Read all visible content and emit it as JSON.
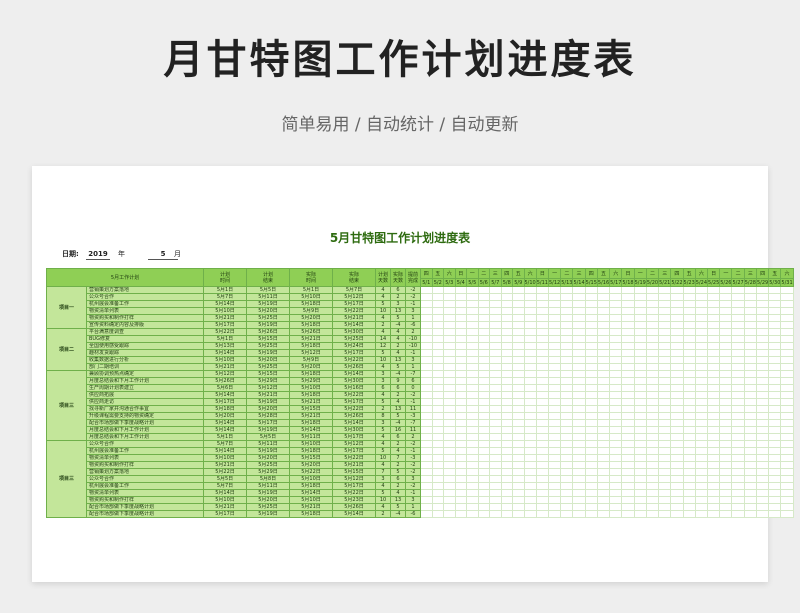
{
  "page": {
    "title": "月甘特图工作计划进度表",
    "subtitle": "简单易用 / 自动统计 / 自动更新"
  },
  "sheet": {
    "title": "5月甘特图工作计划进度表",
    "date_label": "日期:",
    "year": "2019",
    "year_unit": "年",
    "month": "5",
    "month_unit": "月"
  },
  "table": {
    "headers": {
      "plan": "5月工作计划",
      "plan_start": "计划\n时间",
      "plan_end": "计划\n结束",
      "actual_start": "实际\n时间",
      "actual_end": "实际\n结束",
      "plan_days": "计划\n天数",
      "actual_days": "实际\n天数",
      "early_finish": "提前\n完成"
    },
    "weekdays": [
      "四",
      "五",
      "六",
      "日",
      "一",
      "二",
      "三",
      "四",
      "五",
      "六",
      "日",
      "一",
      "二",
      "三",
      "四",
      "五",
      "六",
      "日",
      "一",
      "二",
      "三",
      "四",
      "五",
      "六",
      "日",
      "一",
      "二",
      "三",
      "四",
      "五",
      "六"
    ],
    "dates": [
      "5/1",
      "5/2",
      "5/3",
      "5/4",
      "5/5",
      "5/6",
      "5/7",
      "5/8",
      "5/9",
      "5/10",
      "5/11",
      "5/12",
      "5/13",
      "5/14",
      "5/15",
      "5/16",
      "5/17",
      "5/18",
      "5/19",
      "5/20",
      "5/21",
      "5/22",
      "5/23",
      "5/24",
      "5/25",
      "5/26",
      "5/27",
      "5/28",
      "5/29",
      "5/30",
      "5/31"
    ],
    "projects": [
      {
        "name": "项目一",
        "tasks": [
          [
            "营销策划方案落地",
            "5月1日",
            "5月5日",
            "5月1日",
            "5月7日",
            "4",
            "6",
            "-2"
          ],
          [
            "公众号合作",
            "5月7日",
            "5月11日",
            "5月10日",
            "5月12日",
            "4",
            "2",
            "-2"
          ],
          [
            "杭州展会准备工作",
            "5月14日",
            "5月19日",
            "5月18日",
            "5月17日",
            "5",
            "3",
            "-1"
          ],
          [
            "物资清单列表",
            "5月10日",
            "5月20日",
            "5月9日",
            "5月22日",
            "10",
            "13",
            "3"
          ],
          [
            "物资购买和制作打样",
            "5月21日",
            "5月25日",
            "5月20日",
            "5月21日",
            "4",
            "5",
            "1"
          ],
          [
            "宣传资料确定内容及排版",
            "5月17日",
            "5月19日",
            "5月18日",
            "5月14日",
            "2",
            "-4",
            "-6"
          ]
        ]
      },
      {
        "name": "项目二",
        "tasks": [
          [
            "平台满意度调查",
            "5月22日",
            "5月26日",
            "5月26日",
            "5月30日",
            "4",
            "4",
            "2"
          ],
          [
            "BUG修复",
            "5月1日",
            "5月15日",
            "5月21日",
            "5月25日",
            "14",
            "4",
            "-10"
          ],
          [
            "全国使用感受跟踪",
            "5月13日",
            "5月25日",
            "5月18日",
            "5月24日",
            "12",
            "2",
            "-10"
          ],
          [
            "趣材发货跟踪",
            "5月14日",
            "5月19日",
            "5月12日",
            "5月17日",
            "5",
            "4",
            "-1"
          ],
          [
            "收集数据进行分析",
            "5月10日",
            "5月20日",
            "5月9日",
            "5月22日",
            "10",
            "13",
            "3"
          ],
          [
            "部门二期培训",
            "5月21日",
            "5月25日",
            "5月20日",
            "5月26日",
            "4",
            "5",
            "1"
          ]
        ]
      },
      {
        "name": "项目三",
        "tasks": [
          [
            "兼顾协调预热点确定",
            "5月12日",
            "5月15日",
            "5月18日",
            "5月14日",
            "3",
            "-4",
            "-7"
          ],
          [
            "月度总结会和下月工作计划",
            "5月26日",
            "5月29日",
            "5月29日",
            "5月30日",
            "3",
            "9",
            "6"
          ],
          [
            "生产周期计划表建立",
            "5月6日",
            "5月12日",
            "5月10日",
            "5月16日",
            "6",
            "6",
            "0"
          ],
          [
            "供应商拓展",
            "5月14日",
            "5月21日",
            "5月18日",
            "5月22日",
            "4",
            "2",
            "-2"
          ],
          [
            "供应商走访",
            "5月17日",
            "5月19日",
            "5月21日",
            "5月17日",
            "5",
            "4",
            "-1"
          ],
          [
            "找寻新厂家并沟通合作事宜",
            "5月18日",
            "5月20日",
            "5月15日",
            "5月22日",
            "2",
            "13",
            "11"
          ],
          [
            "升级课程需要支持的物资确定",
            "5月20日",
            "5月28日",
            "5月21日",
            "5月26日",
            "8",
            "5",
            "-3"
          ],
          [
            "配合市场部做下季度战略计划",
            "5月14日",
            "5月17日",
            "5月18日",
            "5月14日",
            "3",
            "-4",
            "-7"
          ],
          [
            "月度总结会和下月工作计划",
            "5月14日",
            "5月19日",
            "5月14日",
            "5月30日",
            "5",
            "16",
            "11"
          ],
          [
            "月度总结会和下月工作计划",
            "5月1日",
            "5月5日",
            "5月11日",
            "5月17日",
            "4",
            "6",
            "2"
          ]
        ]
      },
      {
        "name": "项目三",
        "tasks": [
          [
            "公众号合作",
            "5月7日",
            "5月11日",
            "5月10日",
            "5月12日",
            "4",
            "2",
            "-2"
          ],
          [
            "杭州展会准备工作",
            "5月14日",
            "5月19日",
            "5月18日",
            "5月17日",
            "5",
            "4",
            "-1"
          ],
          [
            "物资清单列表",
            "5月10日",
            "5月20日",
            "5月15日",
            "5月22日",
            "10",
            "7",
            "-3"
          ],
          [
            "物资购买和制作打样",
            "5月21日",
            "5月25日",
            "5月20日",
            "5月21日",
            "4",
            "2",
            "-2"
          ],
          [
            "营销策划方案落地",
            "5月22日",
            "5月29日",
            "5月22日",
            "5月15日",
            "7",
            "5",
            "-2"
          ],
          [
            "公众号合作",
            "5月5日",
            "5月8日",
            "5月10日",
            "5月12日",
            "3",
            "6",
            "3"
          ],
          [
            "杭州展会准备工作",
            "5月7日",
            "5月11日",
            "5月18日",
            "5月17日",
            "4",
            "2",
            "-2"
          ],
          [
            "物资清单列表",
            "5月14日",
            "5月19日",
            "5月14日",
            "5月22日",
            "5",
            "4",
            "-1"
          ],
          [
            "物资购买和制作打样",
            "5月10日",
            "5月20日",
            "5月10日",
            "5月23日",
            "10",
            "13",
            "3"
          ],
          [
            "配合市场部做下季度战略计划",
            "5月21日",
            "5月25日",
            "5月21日",
            "5月26日",
            "4",
            "5",
            "1"
          ],
          [
            "配合市场部做下季度战略计划",
            "5月17日",
            "5月19日",
            "5月18日",
            "5月14日",
            "2",
            "-4",
            "-6"
          ]
        ]
      }
    ]
  }
}
